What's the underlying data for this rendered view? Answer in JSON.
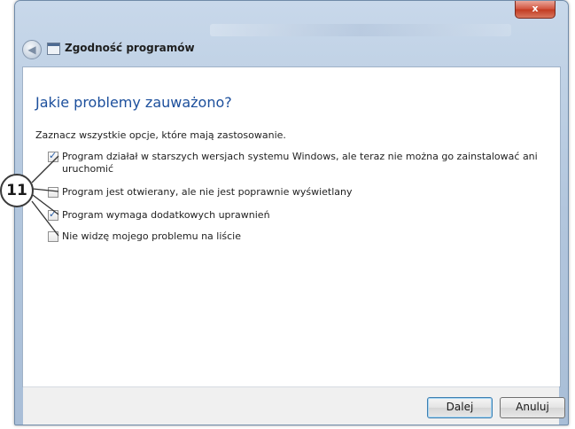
{
  "window": {
    "title": "Zgodność programów",
    "close_label": "x"
  },
  "page": {
    "heading": "Jakie problemy zauważono?",
    "instruction": "Zaznacz wszystkie opcje, które mają zastosowanie."
  },
  "options": [
    {
      "label": "Program działał w starszych wersjach systemu Windows, ale teraz nie można go zainstalować ani uruchomić",
      "checked": true
    },
    {
      "label": "Program jest otwierany, ale nie jest poprawnie wyświetlany",
      "checked": false
    },
    {
      "label": "Program wymaga dodatkowych uprawnień",
      "checked": true
    },
    {
      "label": "Nie widzę mojego problemu na liście",
      "checked": false
    }
  ],
  "annotation": {
    "badge_number": "11"
  },
  "buttons": {
    "next_label": "Dalej",
    "cancel_label": "Anuluj"
  },
  "colors": {
    "heading": "#1c4f9c",
    "close_button": "#c23b22",
    "primary_button_border": "#3c7fb1"
  }
}
